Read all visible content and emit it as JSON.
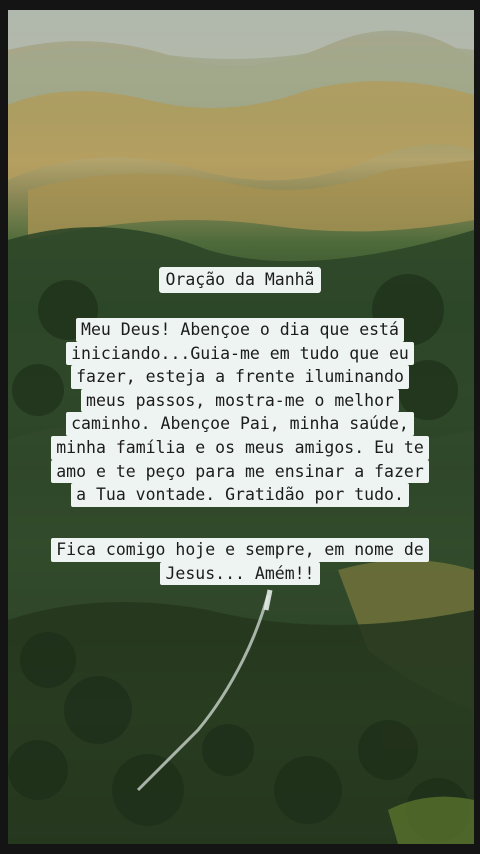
{
  "post": {
    "title": "Oração da Manhã",
    "prayer_lines": [
      "Meu Deus! Abençoe o dia que está",
      "iniciando...Guia-me em tudo que eu",
      "fazer, esteja a frente iluminando",
      "meus passos, mostra-me o melhor",
      "caminho. Abençoe Pai, minha saúde,",
      "minha família e os meus amigos. Eu te",
      "amo e te peço para me ensinar a fazer",
      "a Tua vontade. Gratidão por tudo."
    ],
    "closing_lines": [
      "Fica comigo hoje e sempre, em nome de",
      "Jesus... Amém!!"
    ]
  },
  "colors": {
    "caption_background": "#eef4f1",
    "caption_text": "#1c1c1c"
  }
}
